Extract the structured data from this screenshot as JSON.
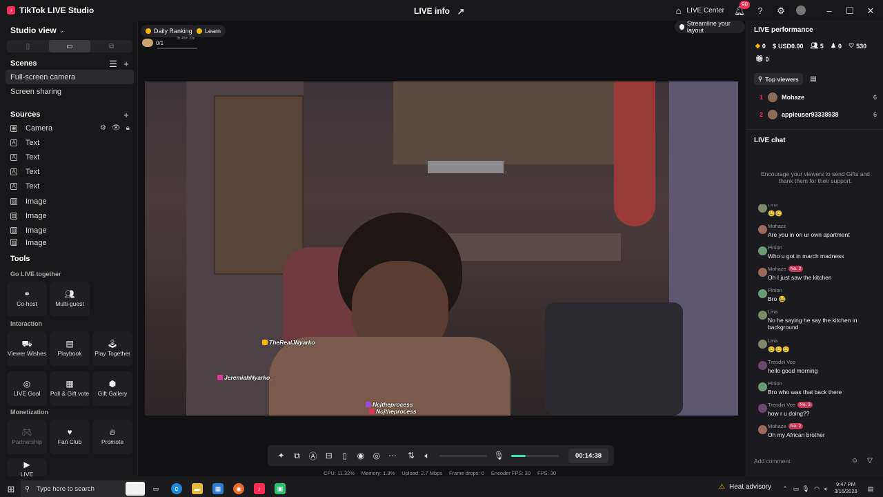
{
  "app": {
    "title": "TikTok LIVE Studio",
    "live_info": "LIVE info",
    "live_center": "LIVE Center",
    "notif_count": "90"
  },
  "sidebar": {
    "studio_view": "Studio view",
    "scenes_title": "Scenes",
    "scenes": [
      "Full-screen camera",
      "Screen sharing"
    ],
    "sources_title": "Sources",
    "sources": [
      {
        "label": "Camera",
        "icon": "camera-icon"
      },
      {
        "label": "Text",
        "icon": "text-icon"
      },
      {
        "label": "Text",
        "icon": "text-icon"
      },
      {
        "label": "Text",
        "icon": "text-icon"
      },
      {
        "label": "Text",
        "icon": "text-icon"
      },
      {
        "label": "Image",
        "icon": "image-icon"
      },
      {
        "label": "Image",
        "icon": "image-icon"
      },
      {
        "label": "Image",
        "icon": "image-icon"
      },
      {
        "label": "Image",
        "icon": "image-icon"
      }
    ],
    "tools_title": "Tools",
    "go_live_together": "Go LIVE together",
    "interaction": "Interaction",
    "monetization": "Monetization",
    "tools": {
      "cohost": "Co-host",
      "multiguest": "Multi-guest",
      "viewer_wishes": "Viewer Wishes",
      "playbook": "Playbook",
      "play_together": "Play Together",
      "live_goal": "LIVE Goal",
      "poll_gift": "Poll & Gift vote",
      "gift_gallery": "Gift Gallery",
      "partnership": "Partnership",
      "fan_club": "Fan Club",
      "promote": "Promote",
      "live": "LIVE"
    }
  },
  "center": {
    "daily_ranking": "Daily Ranking",
    "learn": "Learn",
    "progress": "0/1",
    "progress_time": "3h 45m 33s",
    "streamline": "Streamline your layout",
    "overlay_labels": [
      "TheRealJNyarko",
      "JeremiahNyarko_",
      "Ncjtheprocess",
      "Ncjtheprocess"
    ],
    "timer": "00:14:38",
    "volume_level": 0.3,
    "stats": {
      "cpu": "CPU: 11.32%",
      "memory": "Memory: 1.9%",
      "upload": "Upload: 2.7 Mbps",
      "frame_drops": "Frame drops: 0",
      "encoder_fps": "Encoder FPS: 30",
      "fps": "FPS: 30"
    }
  },
  "right": {
    "perf_title": "LIVE performance",
    "diamonds": "0",
    "usd": "USD0.00",
    "viewers": "5",
    "new_followers": "0",
    "likes": "530",
    "gifts": "0",
    "top_viewers_label": "Top viewers",
    "top_viewers": [
      {
        "rank": "1",
        "name": "Mohaze",
        "count": "6"
      },
      {
        "rank": "2",
        "name": "appleuser93338938",
        "count": "6"
      }
    ],
    "chat_title": "LIVE chat",
    "chat_hint": "Encourage your viewers to send Gifts and thank them for their support.",
    "messages": [
      {
        "user": "Lina",
        "badge": "",
        "text": "😢😢"
      },
      {
        "user": "Mohaze",
        "badge": "",
        "text": "Are you in on ur own apartment"
      },
      {
        "user": "Pinion",
        "badge": "",
        "text": "Who u got in march madness"
      },
      {
        "user": "Mohaze",
        "badge": "No. 2",
        "text": "Oh I just saw the kitchen"
      },
      {
        "user": "Pinion",
        "badge": "",
        "text": "Bro 😂"
      },
      {
        "user": "Lina",
        "badge": "",
        "text": "No he saying he say the kitchen in background"
      },
      {
        "user": "Lina",
        "badge": "",
        "text": "😢😢😢"
      },
      {
        "user": "Trendin Vee",
        "badge": "",
        "text": "hello good morning"
      },
      {
        "user": "Pinion",
        "badge": "",
        "text": "Bro who was that back there"
      },
      {
        "user": "Trendin Vee",
        "badge": "No. 3",
        "text": "how r u doing??"
      },
      {
        "user": "Mohaze",
        "badge": "No. 2",
        "text": "Oh my African brother"
      }
    ],
    "add_comment": "Add comment"
  },
  "taskbar": {
    "search_placeholder": "Type here to search",
    "weather": "Heat advisory",
    "time": "9:47 PM",
    "date": "3/16/2026"
  }
}
